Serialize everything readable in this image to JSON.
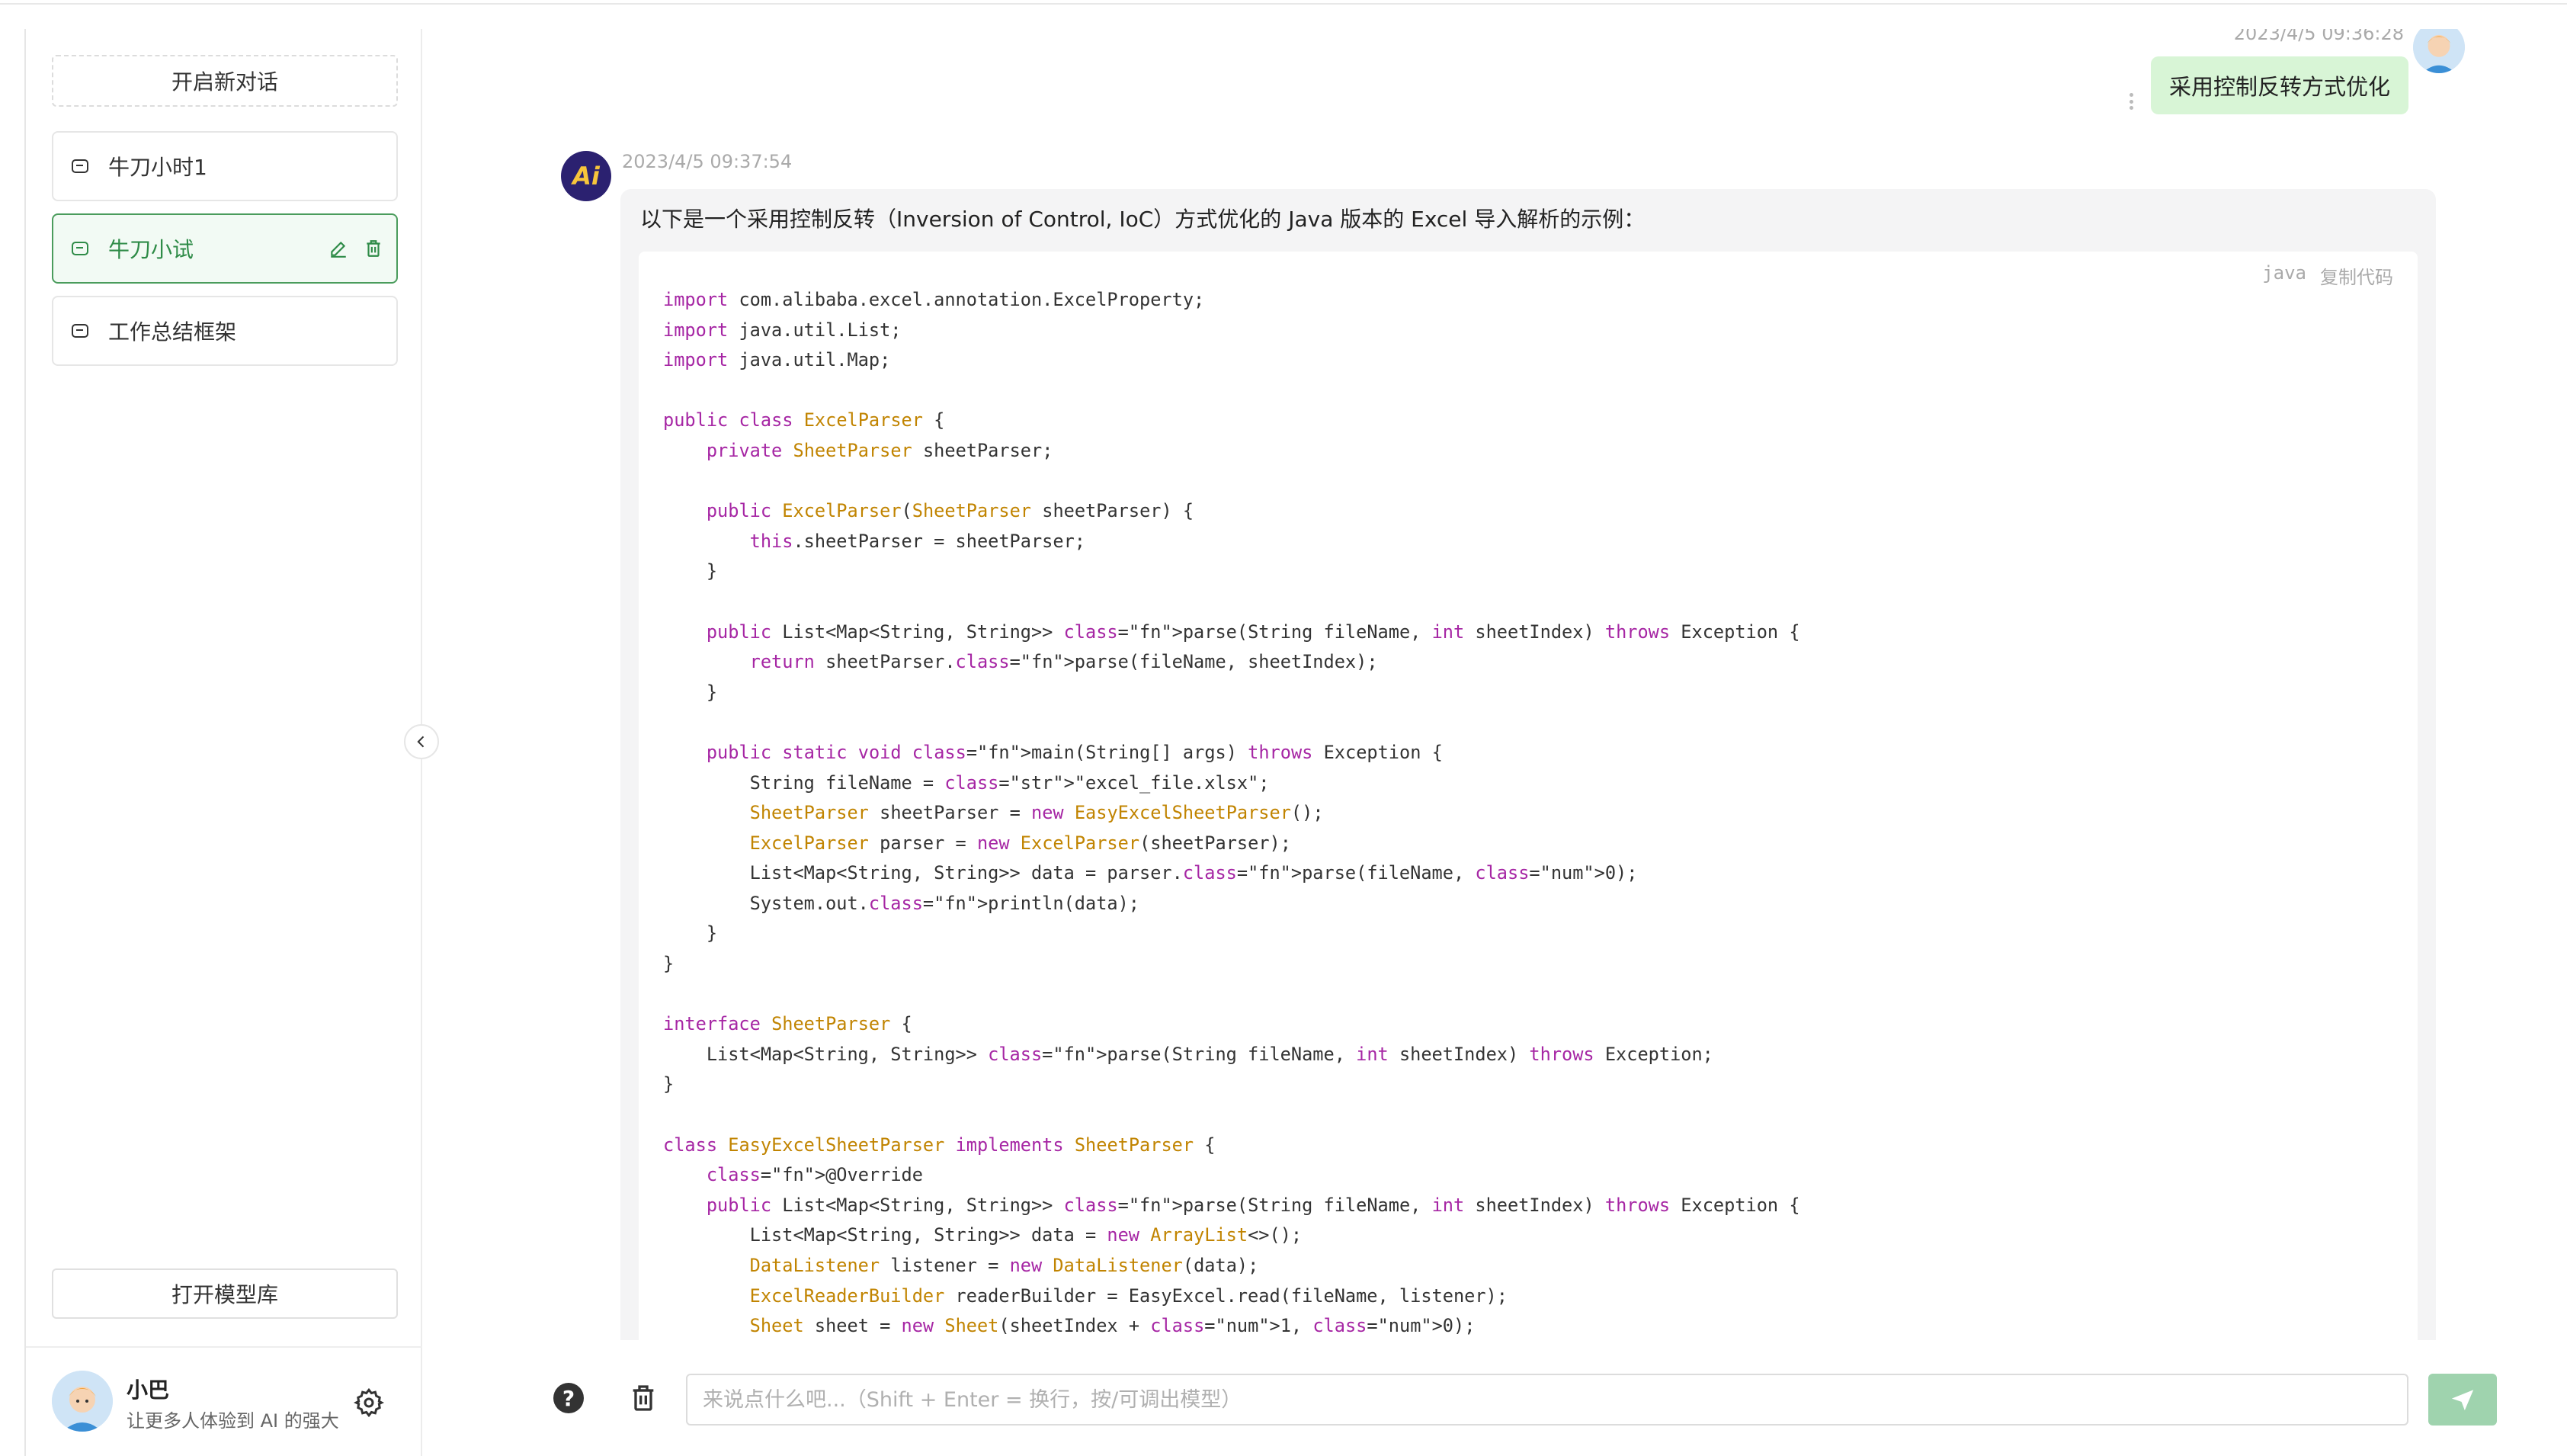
{
  "sidebar": {
    "new_chat_label": "开启新对话",
    "sessions": [
      {
        "title": "牛刀小时1",
        "active": false
      },
      {
        "title": "牛刀小试",
        "active": true
      },
      {
        "title": "工作总结框架",
        "active": false
      }
    ],
    "open_models_label": "打开模型库",
    "user": {
      "name": "小巴",
      "subtitle": "让更多人体验到 AI 的强大"
    }
  },
  "chat": {
    "user_message": {
      "time": "2023/4/5 09:36:28",
      "text": "采用控制反转方式优化"
    },
    "ai_message": {
      "time": "2023/4/5 09:37:54",
      "avatar_text": "Ai",
      "intro": "以下是一个采用控制反转（Inversion of Control, IoC）方式优化的 Java 版本的 Excel 导入解析的示例：",
      "code_lang": "java",
      "copy_label": "复制代码",
      "code_lines": [
        "import com.alibaba.excel.annotation.ExcelProperty;",
        "import java.util.List;",
        "import java.util.Map;",
        "",
        "public class ExcelParser {",
        "    private SheetParser sheetParser;",
        "",
        "    public ExcelParser(SheetParser sheetParser) {",
        "        this.sheetParser = sheetParser;",
        "    }",
        "",
        "    public List<Map<String, String>> parse(String fileName, int sheetIndex) throws Exception {",
        "        return sheetParser.parse(fileName, sheetIndex);",
        "    }",
        "",
        "    public static void main(String[] args) throws Exception {",
        "        String fileName = \"excel_file.xlsx\";",
        "        SheetParser sheetParser = new EasyExcelSheetParser();",
        "        ExcelParser parser = new ExcelParser(sheetParser);",
        "        List<Map<String, String>> data = parser.parse(fileName, 0);",
        "        System.out.println(data);",
        "    }",
        "}",
        "",
        "interface SheetParser {",
        "    List<Map<String, String>> parse(String fileName, int sheetIndex) throws Exception;",
        "}",
        "",
        "class EasyExcelSheetParser implements SheetParser {",
        "    @Override",
        "    public List<Map<String, String>> parse(String fileName, int sheetIndex) throws Exception {",
        "        List<Map<String, String>> data = new ArrayList<>();",
        "        DataListener listener = new DataListener(data);",
        "        ExcelReaderBuilder readerBuilder = EasyExcel.read(fileName, listener);",
        "        Sheet sheet = new Sheet(sheetIndex + 1, 0);"
      ]
    }
  },
  "input": {
    "placeholder": "来说点什么吧...（Shift + Enter = 换行，按/可调出模型）",
    "value": ""
  },
  "colors": {
    "accent": "#4a9c5c",
    "user_bubble": "#d8f5d6",
    "send_button": "#9fd3ae"
  },
  "icons": [
    "chat-icon",
    "edit-icon",
    "delete-icon",
    "gear-icon",
    "chevron-left-icon",
    "help-icon",
    "trash-icon",
    "send-icon"
  ]
}
